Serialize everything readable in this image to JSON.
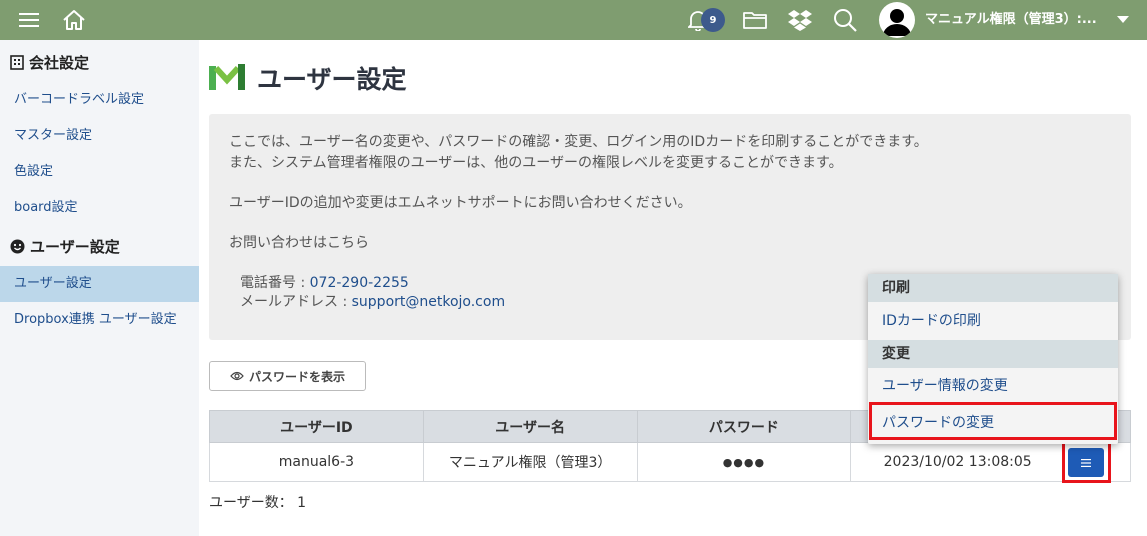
{
  "topbar": {
    "icons": [
      "hamburger-icon",
      "home-icon",
      "bell-icon",
      "folder-icon",
      "dropbox-icon",
      "search-icon",
      "user-avatar-icon",
      "caret-down-icon"
    ],
    "notification_count": "9",
    "user_name": "マニュアル権限（管理3）:...",
    "bar_color": "#7f9d70"
  },
  "sidebar": {
    "section1_title": "会社設定",
    "section1_items": [
      "バーコードラベル設定",
      "マスター設定",
      "色設定",
      "board設定"
    ],
    "section2_title": "ユーザー設定",
    "section2_items": [
      "ユーザー設定",
      "Dropbox連携 ユーザー設定"
    ],
    "active_item": "ユーザー設定"
  },
  "main": {
    "title": "ユーザー設定",
    "info": {
      "line1": "ここでは、ユーザー名の変更や、パスワードの確認・変更、ログイン用のIDカードを印刷することができます。",
      "line2": "また、システム管理者権限のユーザーは、他のユーザーの権限レベルを変更することができます。",
      "line3": "ユーザーIDの追加や変更はエムネットサポートにお問い合わせください。",
      "line4": "お問い合わせはこちら",
      "phone_label": "電話番号 : ",
      "phone": "072-290-2255",
      "email_label": "メールアドレス : ",
      "email": "support@netkojo.com"
    },
    "show_password_button": "パスワードを表示",
    "table": {
      "headers": [
        "ユーザーID",
        "ユーザー名",
        "パスワード",
        ""
      ],
      "rows": [
        {
          "user_id": "manual6-3",
          "user_name": "マニュアル権限（管理3）",
          "password": "●●●●",
          "updated": "2023/10/02 13:08:05"
        }
      ]
    },
    "user_count": "ユーザー数： 1"
  },
  "dropdown": {
    "section1": "印刷",
    "item1": "IDカードの印刷",
    "section2": "変更",
    "item2": "ユーザー情報の変更",
    "item3": "パスワードの変更"
  },
  "colors": {
    "accent": "#1e5bb6",
    "link": "#1f4e8c",
    "highlight": "#e8141b"
  }
}
